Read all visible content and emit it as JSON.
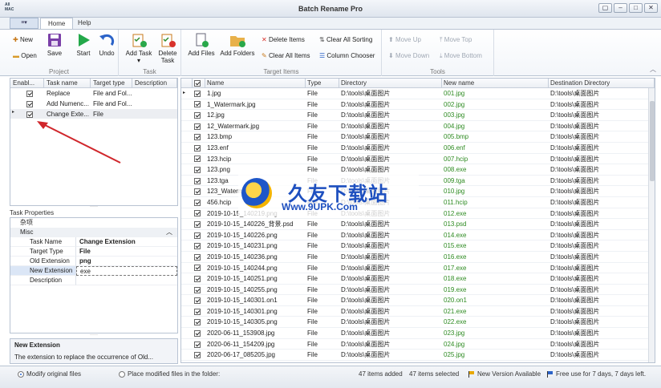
{
  "window": {
    "title": "Batch Rename Pro",
    "icon_text": "All\nMAC"
  },
  "tabs": {
    "file": "",
    "home": "Home",
    "help": "Help"
  },
  "ribbon": {
    "project": {
      "label": "Project",
      "new": "New",
      "open": "Open",
      "save": "Save"
    },
    "task": {
      "label": "Task",
      "start": "Start",
      "undo": "Undo",
      "add_task": "Add Task",
      "delete_task": "Delete Task"
    },
    "target": {
      "label": "Target Items",
      "add_files": "Add Files",
      "add_folders": "Add Folders",
      "delete_items": "Delete Items",
      "clear_all_items": "Clear All Items",
      "clear_all_sorting": "Clear All Sorting",
      "column_chooser": "Column Chooser"
    },
    "tools": {
      "label": "Tools",
      "move_up": "Move Up",
      "move_down": "Move Down",
      "move_top": "Move Top",
      "move_bottom": "Move Bottom"
    }
  },
  "tasks": {
    "headers": [
      "Enabl...",
      "Task name",
      "Target type",
      "Description"
    ],
    "rows": [
      {
        "name": "Replace",
        "type": "File and Fol...",
        "desc": ""
      },
      {
        "name": "Add Numenc...",
        "type": "File and Fol...",
        "desc": ""
      },
      {
        "name": "Change Exte...",
        "type": "File",
        "desc": ""
      }
    ]
  },
  "task_properties": {
    "title": "Task Properties",
    "category_cn": "杂项",
    "category": "Misc",
    "items": [
      {
        "key": "Task Name",
        "value": "Change Extension"
      },
      {
        "key": "Target Type",
        "value": "File"
      },
      {
        "key": "Old Extension",
        "value": "png"
      },
      {
        "key": "New Extension",
        "value": "exe"
      },
      {
        "key": "Description",
        "value": ""
      }
    ],
    "desc_title": "New Extension",
    "desc_text": "The extension to replace the occurrence of Old..."
  },
  "files": {
    "headers": [
      "Name",
      "Type",
      "Directory",
      "New name",
      "Destination Directory"
    ],
    "rows": [
      {
        "name": "1.jpg",
        "type": "File",
        "dir": "D:\\tools\\桌面图片",
        "new": "001.jpg",
        "dest": "D:\\tools\\桌面图片"
      },
      {
        "name": "1_Watermark.jpg",
        "type": "File",
        "dir": "D:\\tools\\桌面图片",
        "new": "002.jpg",
        "dest": "D:\\tools\\桌面图片"
      },
      {
        "name": "12.jpg",
        "type": "File",
        "dir": "D:\\tools\\桌面图片",
        "new": "003.jpg",
        "dest": "D:\\tools\\桌面图片"
      },
      {
        "name": "12_Watermark.jpg",
        "type": "File",
        "dir": "D:\\tools\\桌面图片",
        "new": "004.jpg",
        "dest": "D:\\tools\\桌面图片"
      },
      {
        "name": "123.bmp",
        "type": "File",
        "dir": "D:\\tools\\桌面图片",
        "new": "005.bmp",
        "dest": "D:\\tools\\桌面图片"
      },
      {
        "name": "123.enf",
        "type": "File",
        "dir": "D:\\tools\\桌面图片",
        "new": "006.enf",
        "dest": "D:\\tools\\桌面图片"
      },
      {
        "name": "123.hcip",
        "type": "File",
        "dir": "D:\\tools\\桌面图片",
        "new": "007.hcip",
        "dest": "D:\\tools\\桌面图片"
      },
      {
        "name": "123.png",
        "type": "File",
        "dir": "D:\\tools\\桌面图片",
        "new": "008.exe",
        "dest": "D:\\tools\\桌面图片"
      },
      {
        "name": "123.tga",
        "type": "File",
        "dir": "D:\\tools\\桌面图片",
        "new": "009.tga",
        "dest": "D:\\tools\\桌面图片"
      },
      {
        "name": "123_Waterm...",
        "type": "File",
        "dir": "D:\\tools\\桌面图片",
        "new": "010.jpg",
        "dest": "D:\\tools\\桌面图片"
      },
      {
        "name": "456.hcip",
        "type": "File",
        "dir": "D:\\tools\\桌面图片",
        "new": "011.hcip",
        "dest": "D:\\tools\\桌面图片"
      },
      {
        "name": "2019-10-15_140219.png",
        "type": "File",
        "dir": "D:\\tools\\桌面图片",
        "new": "012.exe",
        "dest": "D:\\tools\\桌面图片"
      },
      {
        "name": "2019-10-15_140226_背景.psd",
        "type": "File",
        "dir": "D:\\tools\\桌面图片",
        "new": "013.psd",
        "dest": "D:\\tools\\桌面图片"
      },
      {
        "name": "2019-10-15_140226.png",
        "type": "File",
        "dir": "D:\\tools\\桌面图片",
        "new": "014.exe",
        "dest": "D:\\tools\\桌面图片"
      },
      {
        "name": "2019-10-15_140231.png",
        "type": "File",
        "dir": "D:\\tools\\桌面图片",
        "new": "015.exe",
        "dest": "D:\\tools\\桌面图片"
      },
      {
        "name": "2019-10-15_140236.png",
        "type": "File",
        "dir": "D:\\tools\\桌面图片",
        "new": "016.exe",
        "dest": "D:\\tools\\桌面图片"
      },
      {
        "name": "2019-10-15_140244.png",
        "type": "File",
        "dir": "D:\\tools\\桌面图片",
        "new": "017.exe",
        "dest": "D:\\tools\\桌面图片"
      },
      {
        "name": "2019-10-15_140251.png",
        "type": "File",
        "dir": "D:\\tools\\桌面图片",
        "new": "018.exe",
        "dest": "D:\\tools\\桌面图片"
      },
      {
        "name": "2019-10-15_140255.png",
        "type": "File",
        "dir": "D:\\tools\\桌面图片",
        "new": "019.exe",
        "dest": "D:\\tools\\桌面图片"
      },
      {
        "name": "2019-10-15_140301.on1",
        "type": "File",
        "dir": "D:\\tools\\桌面图片",
        "new": "020.on1",
        "dest": "D:\\tools\\桌面图片"
      },
      {
        "name": "2019-10-15_140301.png",
        "type": "File",
        "dir": "D:\\tools\\桌面图片",
        "new": "021.exe",
        "dest": "D:\\tools\\桌面图片"
      },
      {
        "name": "2019-10-15_140305.png",
        "type": "File",
        "dir": "D:\\tools\\桌面图片",
        "new": "022.exe",
        "dest": "D:\\tools\\桌面图片"
      },
      {
        "name": "2020-06-11_153908.jpg",
        "type": "File",
        "dir": "D:\\tools\\桌面图片",
        "new": "023.jpg",
        "dest": "D:\\tools\\桌面图片"
      },
      {
        "name": "2020-06-11_154209.jpg",
        "type": "File",
        "dir": "D:\\tools\\桌面图片",
        "new": "024.jpg",
        "dest": "D:\\tools\\桌面图片"
      },
      {
        "name": "2020-06-17_085205.jpg",
        "type": "File",
        "dir": "D:\\tools\\桌面图片",
        "new": "025.jpg",
        "dest": "D:\\tools\\桌面图片"
      }
    ]
  },
  "status": {
    "modify_original": "Modify original files",
    "place_modified": "Place modified files in the folder:",
    "items_added": "47 items added",
    "items_selected": "47 items selected",
    "new_version": "New Version Available",
    "free_use": "Free use for 7 days, 7 days left."
  },
  "watermark": {
    "cn": "久友下载站",
    "en": "Www.9UPK.Com"
  },
  "colors": {
    "accent": "#2b63c8",
    "new_name": "#2e8b22",
    "annotation_arrow": "#d0262b"
  }
}
